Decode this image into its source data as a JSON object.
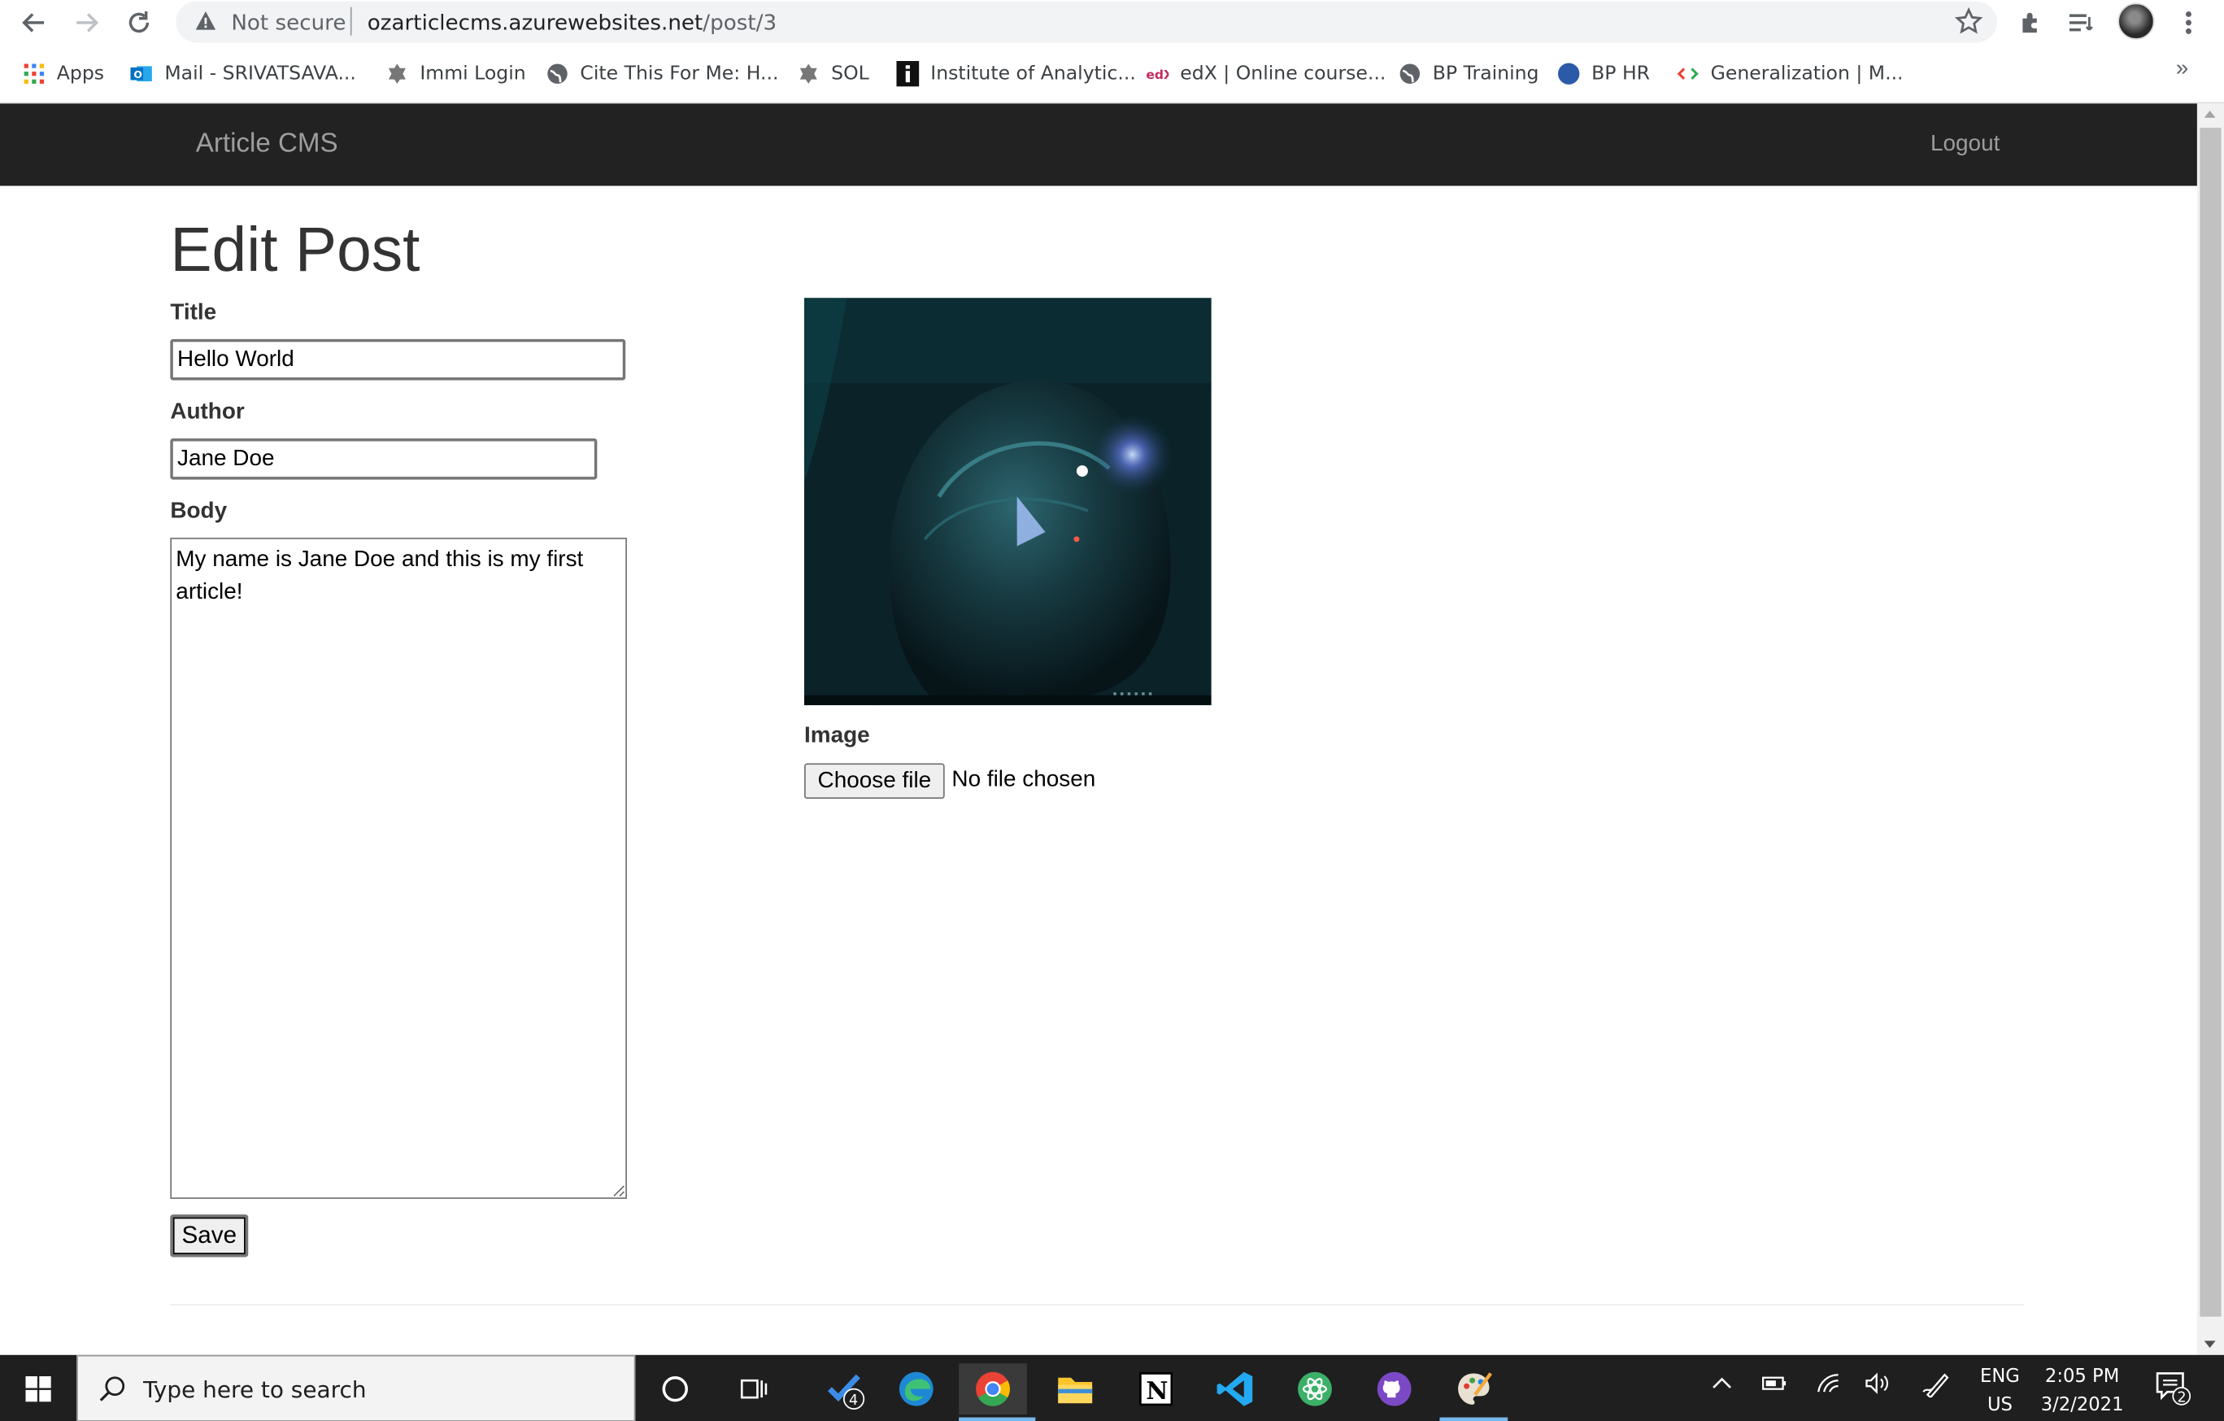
{
  "browser": {
    "security_label": "Not secure",
    "url_domain": "ozarticlecms.azurewebsites.net",
    "url_path": "/post/3",
    "bookmarks": [
      "Apps",
      "Mail - SRIVATSAVA...",
      "Immi Login",
      "Cite This For Me: H...",
      "SOL",
      "Institute of Analytic...",
      "edX | Online course...",
      "BP Training",
      "BP HR",
      "Generalization  |  M..."
    ],
    "more_bookmarks": "»"
  },
  "navbar": {
    "brand": "Article CMS",
    "logout": "Logout"
  },
  "form": {
    "heading": "Edit Post",
    "title_label": "Title",
    "title_value": "Hello World",
    "author_label": "Author",
    "author_value": "Jane Doe",
    "body_label": "Body",
    "body_value": "My name is Jane Doe and this is my first article!",
    "image_label": "Image",
    "choose_file": "Choose file",
    "no_file": "No file chosen",
    "save": "Save"
  },
  "taskbar": {
    "search_placeholder": "Type here to search",
    "todo_badge": "4",
    "lang_primary": "ENG",
    "lang_region": "US",
    "time": "2:05 PM",
    "date": "3/2/2021",
    "notification_count": "2"
  },
  "colors": {
    "navbar_bg": "#222222",
    "navbar_text": "#9d9d9d",
    "taskbar_bg": "#1f1f1f"
  }
}
